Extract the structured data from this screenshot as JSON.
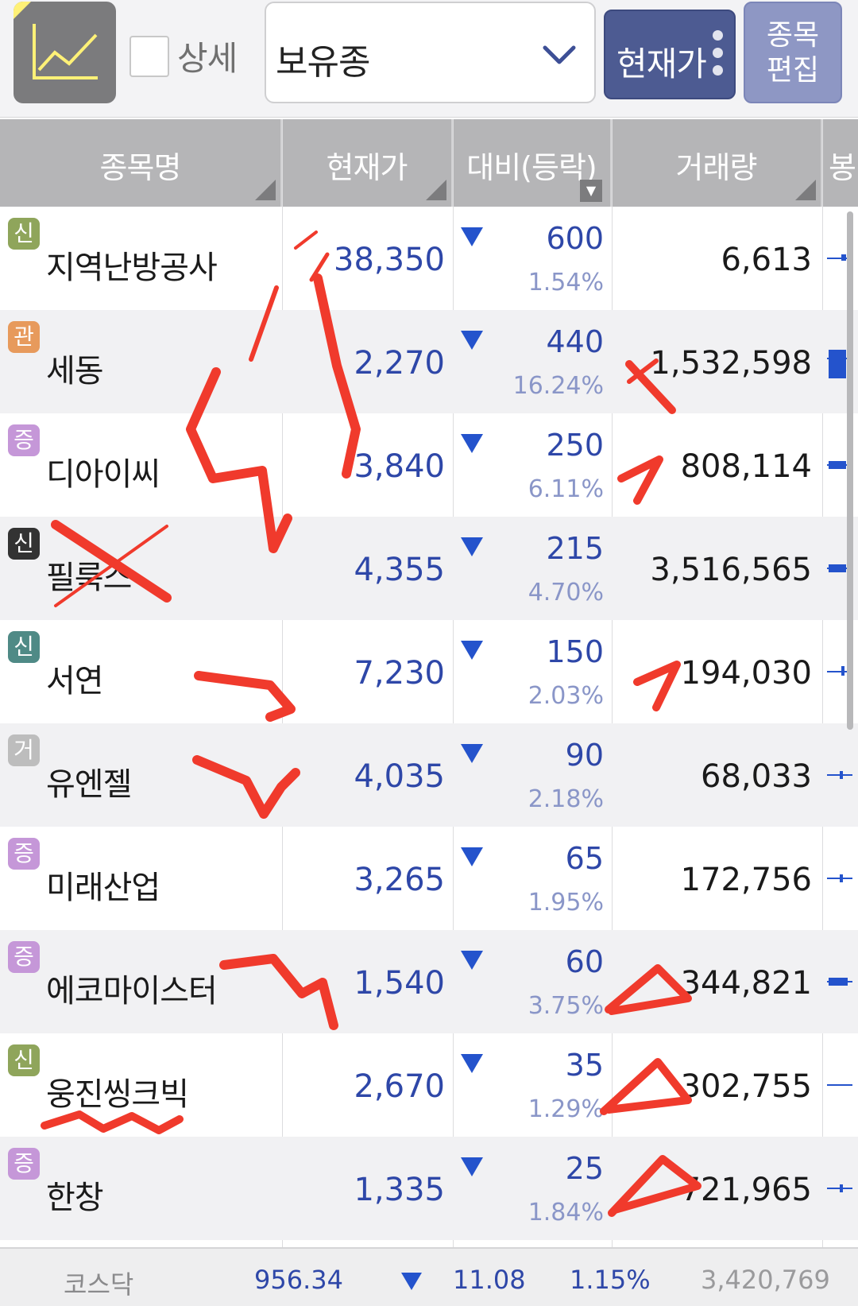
{
  "toolbar": {
    "chart_icon": "line-chart-icon",
    "detail_checkbox_label": "상세",
    "group_select_value": "보유종",
    "price_button_label": "현재가",
    "edit_button_line1": "종목",
    "edit_button_line2": "편집"
  },
  "columns": {
    "name": "종목명",
    "price": "현재가",
    "change": "대비(등락)",
    "volume": "거래량",
    "candle": "봉"
  },
  "rows": [
    {
      "badge": "신",
      "badge_color": "#8fa55b",
      "name": "지역난방공사",
      "price": "38,350",
      "change": "600",
      "pct": "1.54%",
      "volume": "6,613"
    },
    {
      "badge": "관",
      "badge_color": "#e79a5c",
      "name": "세동",
      "price": "2,270",
      "change": "440",
      "pct": "16.24%",
      "volume": "1,532,598"
    },
    {
      "badge": "증",
      "badge_color": "#c597d8",
      "name": "디아이씨",
      "price": "3,840",
      "change": "250",
      "pct": "6.11%",
      "volume": "808,114"
    },
    {
      "badge": "신",
      "badge_color": "#333333",
      "name": "필룩스",
      "price": "4,355",
      "change": "215",
      "pct": "4.70%",
      "volume": "3,516,565"
    },
    {
      "badge": "신",
      "badge_color": "#4f8a86",
      "name": "서연",
      "price": "7,230",
      "change": "150",
      "pct": "2.03%",
      "volume": "194,030"
    },
    {
      "badge": "거",
      "badge_color": "#bdbdbd",
      "name": "유엔젤",
      "price": "4,035",
      "change": "90",
      "pct": "2.18%",
      "volume": "68,033"
    },
    {
      "badge": "증",
      "badge_color": "#c597d8",
      "name": "미래산업",
      "price": "3,265",
      "change": "65",
      "pct": "1.95%",
      "volume": "172,756"
    },
    {
      "badge": "증",
      "badge_color": "#c597d8",
      "name": "에코마이스터",
      "price": "1,540",
      "change": "60",
      "pct": "3.75%",
      "volume": "344,821"
    },
    {
      "badge": "신",
      "badge_color": "#8fa55b",
      "name": "웅진씽크빅",
      "price": "2,670",
      "change": "35",
      "pct": "1.29%",
      "volume": "302,755"
    },
    {
      "badge": "증",
      "badge_color": "#c597d8",
      "name": "한창",
      "price": "1,335",
      "change": "25",
      "pct": "1.84%",
      "volume": "721,965"
    }
  ],
  "footer": {
    "index_name": "코스닥",
    "index_value": "956.34",
    "index_change": "11.08",
    "index_pct": "1.15%",
    "index_volume": "3,420,769"
  },
  "colors": {
    "down_blue": "#2453cc",
    "price_text": "#2e47a8",
    "header_bg": "#b5b5b7",
    "annotation_red": "#f03a2c"
  }
}
